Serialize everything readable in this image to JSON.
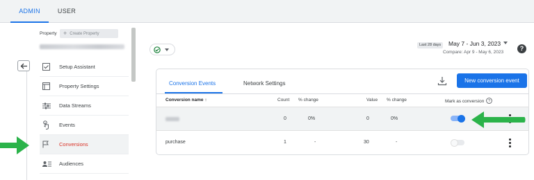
{
  "top_tabs": [
    {
      "label": "ADMIN",
      "active": true
    },
    {
      "label": "USER",
      "active": false
    }
  ],
  "property": {
    "label": "Property",
    "create_button": "Create Property"
  },
  "nav_items": [
    {
      "label": "Setup Assistant",
      "icon": "checkbox-icon",
      "active": false
    },
    {
      "label": "Property Settings",
      "icon": "settings-window-icon",
      "active": false
    },
    {
      "label": "Data Streams",
      "icon": "data-streams-icon",
      "active": false
    },
    {
      "label": "Events",
      "icon": "touch-icon",
      "active": false
    },
    {
      "label": "Conversions",
      "icon": "flag-icon",
      "active": true
    },
    {
      "label": "Audiences",
      "icon": "audiences-icon",
      "active": false
    }
  ],
  "date": {
    "badge": "Last 28 days",
    "range": "May 7 - Jun 3, 2023",
    "compare": "Compare: Apr 9 - May 6, 2023"
  },
  "card": {
    "tabs": [
      {
        "label": "Conversion Events",
        "active": true
      },
      {
        "label": "Network Settings",
        "active": false
      }
    ],
    "new_button": "New conversion event",
    "columns": {
      "name": "Conversion name",
      "count": "Count",
      "count_change": "% change",
      "value": "Value",
      "value_change": "% change",
      "mark": "Mark as conversion"
    },
    "rows": [
      {
        "name": "",
        "name_blurred": true,
        "count": "0",
        "count_change": "0%",
        "value": "0",
        "value_change": "0%",
        "marked": true
      },
      {
        "name": "purchase",
        "name_blurred": false,
        "count": "1",
        "count_change": "-",
        "value": "30",
        "value_change": "-",
        "marked": false
      }
    ]
  },
  "colors": {
    "accent": "#1a73e8",
    "active_nav_text": "#d93025",
    "annotation_arrow": "#2bb34a"
  }
}
